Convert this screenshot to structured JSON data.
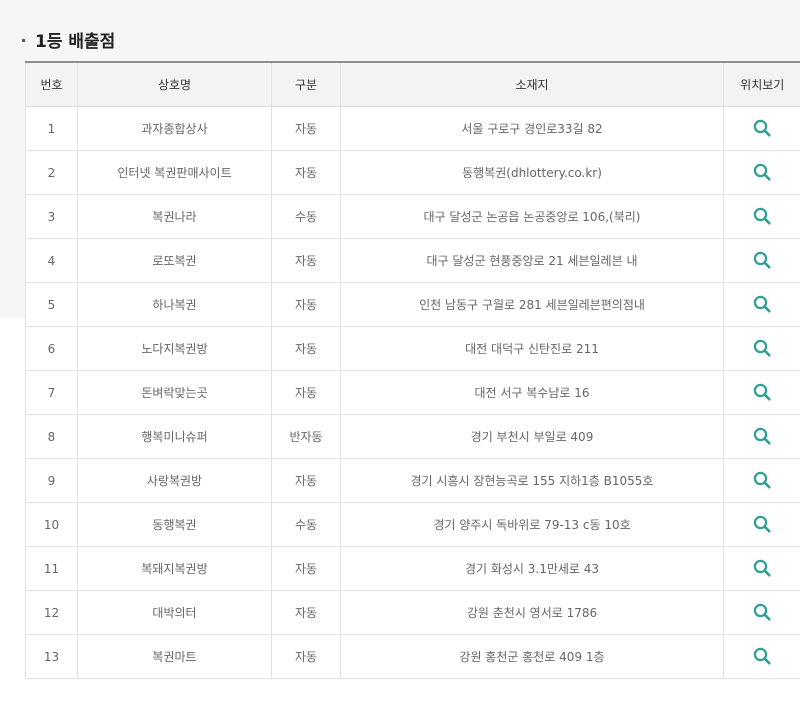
{
  "section": {
    "title": "1등 배출점"
  },
  "table": {
    "headers": [
      "번호",
      "상호명",
      "구분",
      "소재지",
      "위치보기"
    ],
    "rows": [
      {
        "no": "1",
        "name": "과자종합상사",
        "type": "자동",
        "address": "서울 구로구 경인로33길 82"
      },
      {
        "no": "2",
        "name": "인터넷 복권판매사이트",
        "type": "자동",
        "address": "동행복권(dhlottery.co.kr)"
      },
      {
        "no": "3",
        "name": "복권나라",
        "type": "수동",
        "address": "대구 달성군 논공읍 논공중앙로 106,(북리)"
      },
      {
        "no": "4",
        "name": "로또복권",
        "type": "자동",
        "address": "대구 달성군 현풍중앙로 21 세븐일레븐 내"
      },
      {
        "no": "5",
        "name": "하나복권",
        "type": "자동",
        "address": "인천 남동구 구월로 281 세븐일레븐편의점내"
      },
      {
        "no": "6",
        "name": "노다지복권방",
        "type": "자동",
        "address": "대전 대덕구 신탄진로 211"
      },
      {
        "no": "7",
        "name": "돈벼락맞는곳",
        "type": "자동",
        "address": "대전 서구 복수남로 16"
      },
      {
        "no": "8",
        "name": "행복미니슈퍼",
        "type": "반자동",
        "address": "경기 부천시 부일로 409"
      },
      {
        "no": "9",
        "name": "사랑복권방",
        "type": "자동",
        "address": "경기 시흥시 장현능곡로 155 지하1층 B1055호"
      },
      {
        "no": "10",
        "name": "동행복권",
        "type": "수동",
        "address": "경기 양주시 독바위로 79-13 c동 10호"
      },
      {
        "no": "11",
        "name": "복돼지복권방",
        "type": "자동",
        "address": "경기 화성시 3.1만세로 43"
      },
      {
        "no": "12",
        "name": "대박의터",
        "type": "자동",
        "address": "강원 춘천시 영서로 1786"
      },
      {
        "no": "13",
        "name": "복권마트",
        "type": "자동",
        "address": "강원 홍천군 홍천로 409 1층"
      }
    ]
  },
  "icons": {
    "location": "search-icon"
  },
  "colors": {
    "icon": "#2f9e93",
    "header_bg": "#f3f3f3",
    "panel_bg": "#f6f6f6"
  }
}
